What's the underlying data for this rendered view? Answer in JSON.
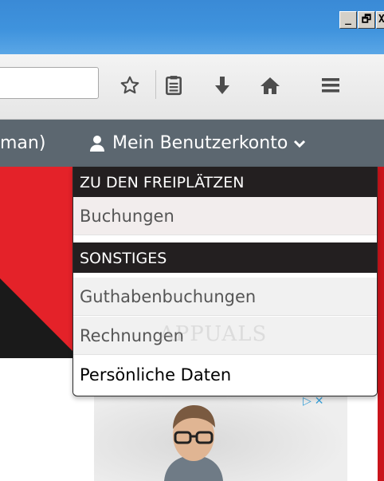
{
  "window": {
    "minimize_label": "_",
    "restore_label": "🗗",
    "close_label": "X"
  },
  "toolbar": {
    "url_value": "",
    "icons": [
      "star-icon",
      "reading-list-icon",
      "download-icon",
      "home-icon",
      "menu-icon"
    ]
  },
  "navbar": {
    "prev_item_text": "man)",
    "account_label": "Mein Benutzerkonto",
    "user_icon": "user-icon",
    "chevron_icon": "chevron-down-icon"
  },
  "dropdown": {
    "section1_header": "ZU DEN FREIPLÄTZEN",
    "item_buchungen": "Buchungen",
    "section2_header": "SONSTIGES",
    "item_guthaben": "Guthabenbuchungen",
    "item_rechnungen": "Rechnungen",
    "item_persoenlich": "Persönliche Daten"
  },
  "watermark": "APPUALS",
  "ad": {
    "badge_icons": [
      "ad-choices-icon",
      "ad-close-icon"
    ]
  },
  "colors": {
    "titlebar": "#3f93dd",
    "navbar": "#5c6770",
    "dropdown_header": "#231f20",
    "banner_red": "#e42229"
  }
}
